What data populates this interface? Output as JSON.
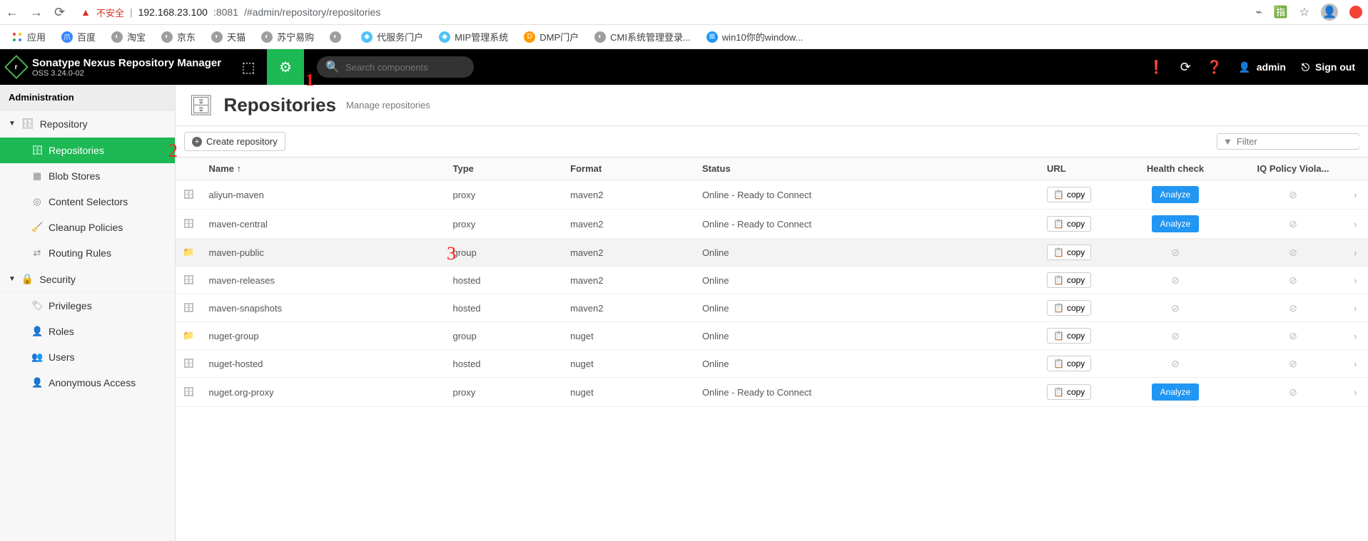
{
  "browser": {
    "insecure_label": "不安全",
    "url_host": "192.168.23.100",
    "url_port": ":8081",
    "url_path": "/#admin/repository/repositories",
    "bookmarks": [
      {
        "label": "应用"
      },
      {
        "label": "百度"
      },
      {
        "label": "淘宝"
      },
      {
        "label": "京东"
      },
      {
        "label": "天猫"
      },
      {
        "label": "苏宁易购"
      },
      {
        "label": ""
      },
      {
        "label": "代服务门户"
      },
      {
        "label": "MIP管理系统"
      },
      {
        "label": "DMP门户"
      },
      {
        "label": "CMI系统管理登录..."
      },
      {
        "label": "win10你的window..."
      }
    ]
  },
  "header": {
    "title": "Sonatype Nexus Repository Manager",
    "version": "OSS 3.24.0-02",
    "search_placeholder": "Search components",
    "user": "admin",
    "signout": "Sign out"
  },
  "sidebar": {
    "section": "Administration",
    "groups": [
      {
        "label": "Repository",
        "items": [
          {
            "label": "Repositories",
            "active": true,
            "mark": "2"
          },
          {
            "label": "Blob Stores"
          },
          {
            "label": "Content Selectors"
          },
          {
            "label": "Cleanup Policies"
          },
          {
            "label": "Routing Rules"
          }
        ]
      },
      {
        "label": "Security",
        "items": [
          {
            "label": "Privileges"
          },
          {
            "label": "Roles"
          },
          {
            "label": "Users"
          },
          {
            "label": "Anonymous Access"
          }
        ]
      }
    ]
  },
  "page": {
    "title": "Repositories",
    "subtitle": "Manage repositories",
    "create_btn": "Create repository",
    "filter_placeholder": "Filter",
    "columns": {
      "name": "Name",
      "type": "Type",
      "format": "Format",
      "status": "Status",
      "url": "URL",
      "health": "Health check",
      "iq": "IQ Policy Viola..."
    },
    "copy_label": "copy",
    "analyze_label": "Analyze",
    "rows": [
      {
        "name": "aliyun-maven",
        "type": "proxy",
        "format": "maven2",
        "status": "Online - Ready to Connect",
        "health": "analyze"
      },
      {
        "name": "maven-central",
        "type": "proxy",
        "format": "maven2",
        "status": "Online - Ready to Connect",
        "health": "analyze"
      },
      {
        "name": "maven-public",
        "type": "group",
        "format": "maven2",
        "status": "Online",
        "health": "ban",
        "hi": true,
        "mark": "3"
      },
      {
        "name": "maven-releases",
        "type": "hosted",
        "format": "maven2",
        "status": "Online",
        "health": "ban"
      },
      {
        "name": "maven-snapshots",
        "type": "hosted",
        "format": "maven2",
        "status": "Online",
        "health": "ban"
      },
      {
        "name": "nuget-group",
        "type": "group",
        "format": "nuget",
        "status": "Online",
        "health": "ban"
      },
      {
        "name": "nuget-hosted",
        "type": "hosted",
        "format": "nuget",
        "status": "Online",
        "health": "ban"
      },
      {
        "name": "nuget.org-proxy",
        "type": "proxy",
        "format": "nuget",
        "status": "Online - Ready to Connect",
        "health": "analyze"
      }
    ]
  },
  "annotations": {
    "gear_mark": "1"
  }
}
